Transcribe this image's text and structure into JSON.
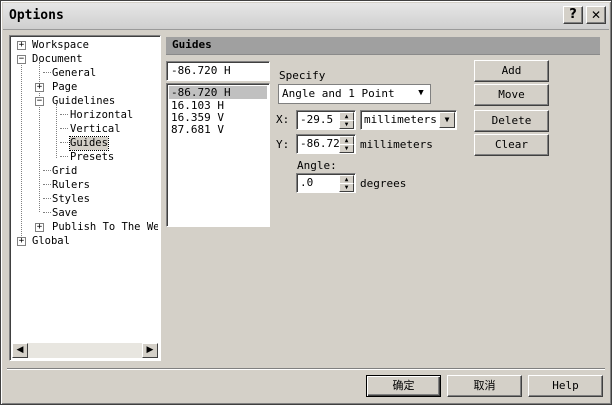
{
  "window": {
    "title": "Options",
    "help_glyph": "?",
    "close_glyph": "✕"
  },
  "tree": {
    "items": [
      {
        "label": "Workspace",
        "expander": "+"
      },
      {
        "label": "Document",
        "expander": "−"
      },
      {
        "label": "General"
      },
      {
        "label": "Page",
        "expander": "+"
      },
      {
        "label": "Guidelines",
        "expander": "−"
      },
      {
        "label": "Horizontal"
      },
      {
        "label": "Vertical"
      },
      {
        "label": "Guides"
      },
      {
        "label": "Presets"
      },
      {
        "label": "Grid"
      },
      {
        "label": "Rulers"
      },
      {
        "label": "Styles"
      },
      {
        "label": "Save"
      },
      {
        "label": "Publish To The Web",
        "expander": "+"
      },
      {
        "label": "Global",
        "expander": "+"
      }
    ],
    "scroll_left": "◀",
    "scroll_right": "▶"
  },
  "panel": {
    "header": "Guides",
    "guide_input_value": "-86.720 H",
    "guides": [
      "-86.720 H",
      "16.103 H",
      "16.359 V",
      "87.681 V"
    ],
    "specify_label": "Specify",
    "specify_value": "Angle and 1 Point",
    "x_label": "X:",
    "x_value": "-29.5",
    "x_unit": "millimeters",
    "y_label": "Y:",
    "y_value": "-86.72",
    "y_unit": "millimeters",
    "angle_label": "Angle:",
    "angle_value": ".0",
    "angle_unit": "degrees",
    "buttons": {
      "add": "Add",
      "move": "Move",
      "delete": "Delete",
      "clear": "Clear"
    }
  },
  "footer": {
    "ok": "确定",
    "cancel": "取消",
    "help": "Help"
  }
}
